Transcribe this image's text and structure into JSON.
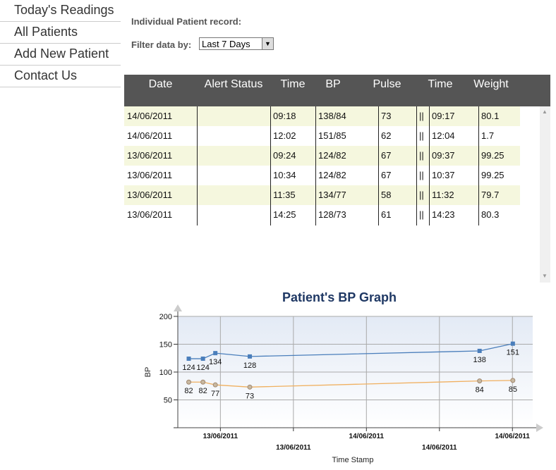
{
  "nav": {
    "items": [
      {
        "label": "Today's Readings"
      },
      {
        "label": "All Patients"
      },
      {
        "label": "Add New Patient"
      },
      {
        "label": "Contact Us"
      }
    ]
  },
  "record_label": "Individual Patient record:",
  "filter": {
    "label": "Filter data by:",
    "selected": "Last 7 Days"
  },
  "table": {
    "headers": [
      "Date",
      "Alert Status",
      "Time",
      "BP",
      "Pulse",
      "",
      "Time",
      "Weight"
    ],
    "rows": [
      [
        "14/06/2011",
        "",
        "09:18",
        "138/84",
        "73",
        "||",
        "09:17",
        "80.1"
      ],
      [
        "14/06/2011",
        "",
        "12:02",
        "151/85",
        "62",
        "||",
        "12:04",
        "1.7"
      ],
      [
        "13/06/2011",
        "",
        "09:24",
        "124/82",
        "67",
        "||",
        "09:37",
        "99.25"
      ],
      [
        "13/06/2011",
        "",
        "10:34",
        "124/82",
        "67",
        "||",
        "10:37",
        "99.25"
      ],
      [
        "13/06/2011",
        "",
        "11:35",
        "134/77",
        "58",
        "||",
        "11:32",
        "79.7"
      ],
      [
        "13/06/2011",
        "",
        "14:25",
        "128/73",
        "61",
        "||",
        "14:23",
        "80.3"
      ]
    ]
  },
  "chart_data": {
    "type": "line",
    "title": "Patient's BP Graph",
    "xlabel": "Time Stamp",
    "ylabel": "BP",
    "ylim": [
      0,
      200
    ],
    "yticks": [
      50,
      100,
      150,
      200
    ],
    "xlim": [
      "2011-06-13 08:30",
      "2011-06-14 13:40"
    ],
    "xticks": [
      {
        "t": "2011-06-13 12:00",
        "label": "13/06/2011"
      },
      {
        "t": "2011-06-13 18:00",
        "label": "13/06/2011"
      },
      {
        "t": "2011-06-14 00:00",
        "label": "14/06/2011"
      },
      {
        "t": "2011-06-14 06:00",
        "label": "14/06/2011"
      },
      {
        "t": "2011-06-14 12:00",
        "label": "14/06/2011"
      }
    ],
    "x": [
      "2011-06-13 09:24",
      "2011-06-13 10:34",
      "2011-06-13 11:35",
      "2011-06-13 14:25",
      "2011-06-14 09:18",
      "2011-06-14 12:02"
    ],
    "grid": true,
    "legend": "none",
    "series": [
      {
        "values": [
          124,
          124,
          134,
          128,
          138,
          151
        ],
        "color": "#4a7ebb"
      },
      {
        "values": [
          82,
          82,
          77,
          73,
          84,
          85
        ],
        "color": "#f0b060",
        "marker_color": "#a08870"
      }
    ]
  }
}
